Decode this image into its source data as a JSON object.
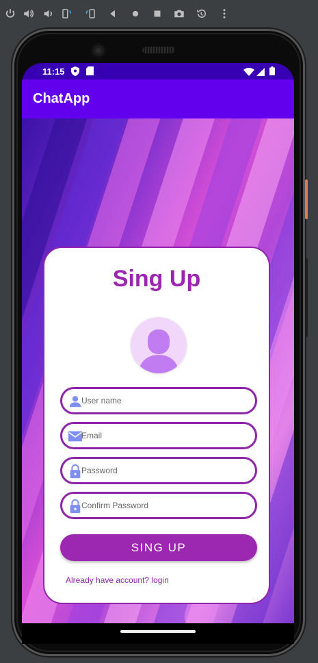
{
  "emulator_toolbar": {
    "icons": [
      "power-icon",
      "volume-up-icon",
      "volume-down-icon",
      "rotate-left-icon",
      "rotate-right-icon",
      "back-icon",
      "home-icon",
      "overview-icon",
      "camera-icon",
      "replay-icon",
      "more-icon"
    ]
  },
  "status_bar": {
    "time": "11:15",
    "left_icons": [
      "shield-icon",
      "sd-card-icon"
    ],
    "right_icons": [
      "wifi-icon",
      "signal-icon",
      "battery-icon"
    ]
  },
  "app_bar": {
    "title": "ChatApp"
  },
  "signup": {
    "title": "Sing Up",
    "fields": {
      "username": {
        "placeholder": "User name",
        "value": ""
      },
      "email": {
        "placeholder": "Email",
        "value": ""
      },
      "password": {
        "placeholder": "Password",
        "value": ""
      },
      "confirm_password": {
        "placeholder": "Confirm Password",
        "value": ""
      }
    },
    "button_label": "SING UP",
    "login_link": "Already have account? login"
  },
  "colors": {
    "status_bar": "#3700b3",
    "app_bar": "#6200ee",
    "accent": "#9c27b0",
    "field_icon": "#7e8ef1",
    "avatar_bg": "#f1d8fb",
    "avatar_fg": "#c27cf1"
  }
}
